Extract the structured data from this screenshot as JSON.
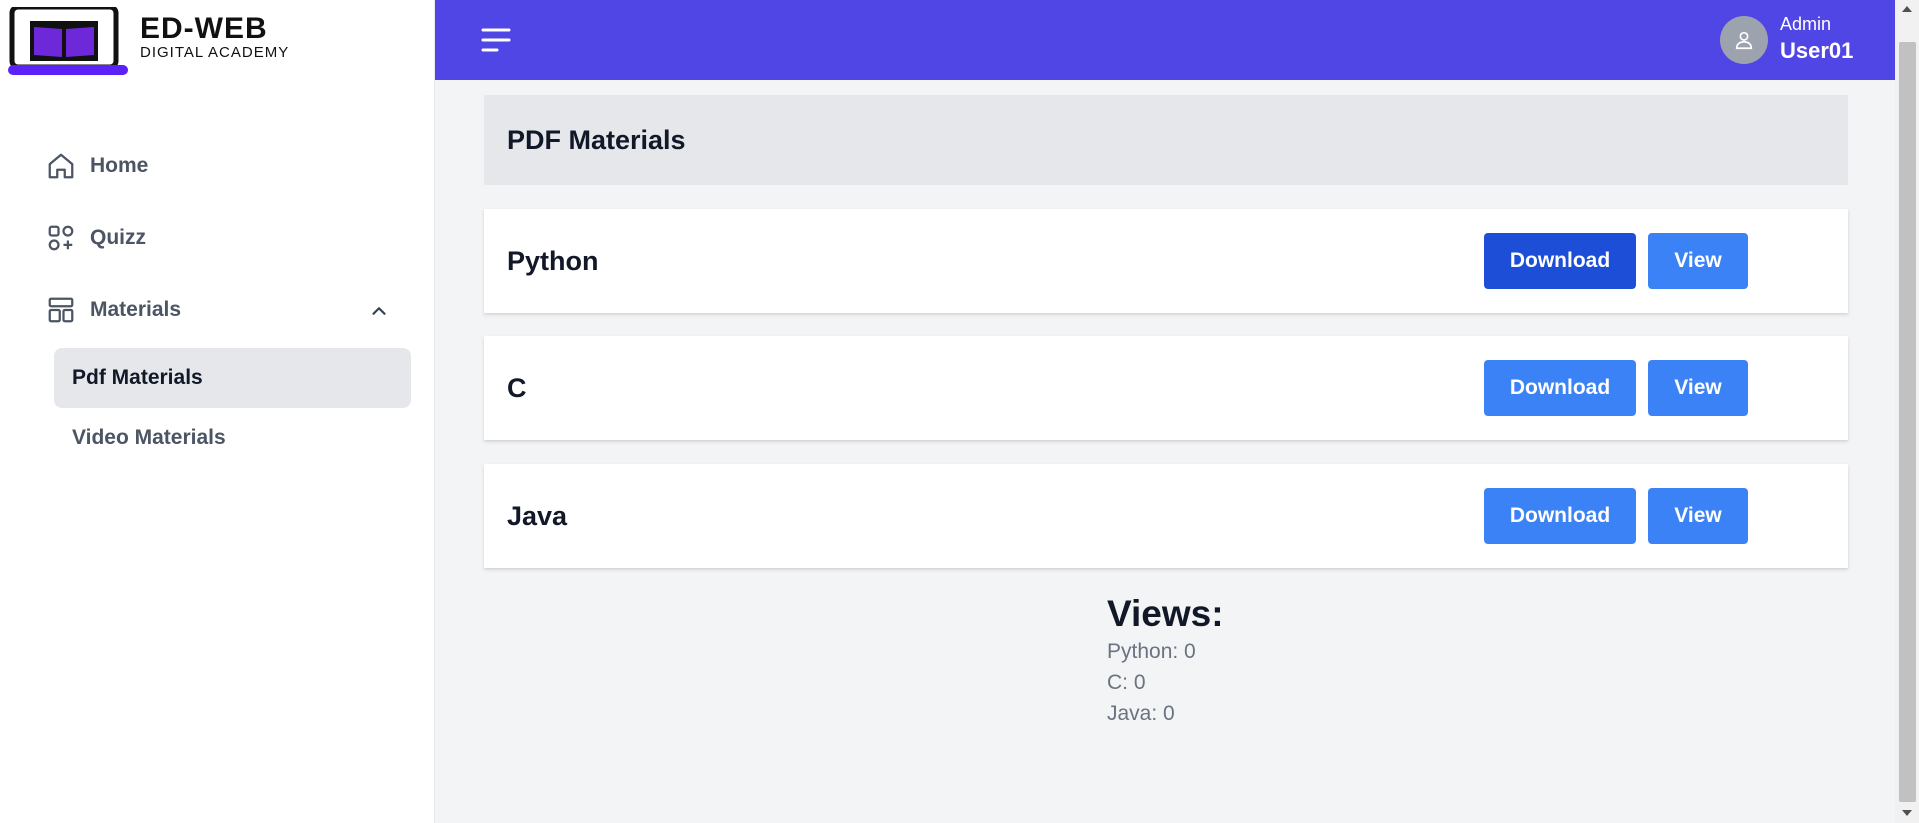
{
  "brand": {
    "name": "ED-WEB",
    "subtitle": "DIGITAL ACADEMY",
    "accent_color": "#5b21f6"
  },
  "sidebar": {
    "items": [
      {
        "label": "Home",
        "icon": "home-icon"
      },
      {
        "label": "Quizz",
        "icon": "apps-add-icon"
      },
      {
        "label": "Materials",
        "icon": "layout-icon",
        "expanded": true
      }
    ],
    "submenu": [
      {
        "label": "Pdf Materials",
        "active": true
      },
      {
        "label": "Video Materials",
        "active": false
      }
    ]
  },
  "topbar": {
    "color": "#4f46e5",
    "menu_icon": "hamburger-icon",
    "user_role": "Admin",
    "user_name": "User01",
    "avatar_icon": "user-icon"
  },
  "main": {
    "title": "PDF Materials",
    "download_label": "Download",
    "view_label": "View",
    "materials": [
      {
        "name": "Python"
      },
      {
        "name": "C"
      },
      {
        "name": "Java"
      }
    ],
    "views": {
      "title": "Views:",
      "lines": [
        "Python: 0",
        "C: 0",
        "Java: 0"
      ]
    }
  },
  "colors": {
    "button": "#3b82f6",
    "button_active": "#1d4ed8",
    "sidebar_active": "#e5e7eb",
    "background": "#f3f4f6"
  }
}
